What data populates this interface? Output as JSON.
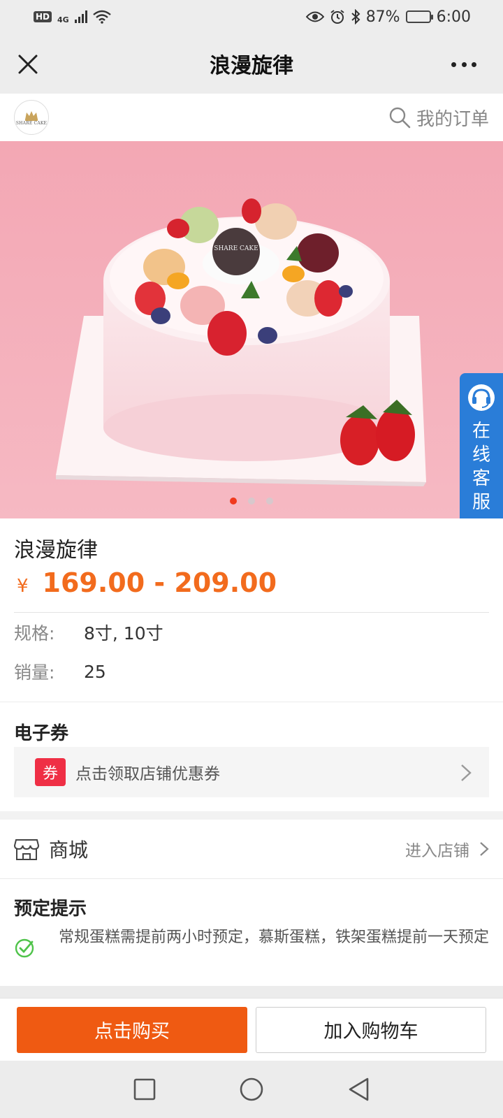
{
  "status_bar": {
    "hd": "HD",
    "network": "4G",
    "battery_percent": "87%",
    "battery_level": 0.87,
    "time": "6:00"
  },
  "header": {
    "title": "浪漫旋律"
  },
  "shop": {
    "logo_text": "SHARE CAKE",
    "orders_label": "我的订单"
  },
  "banner": {
    "image_count": 3,
    "active_index": 0,
    "topper_text": "SHARE CAKE"
  },
  "service": {
    "label": "在线客服"
  },
  "product": {
    "name": "浪漫旋律",
    "currency": "¥",
    "price_range": "169.00 - 209.00",
    "spec_label": "规格:",
    "spec_value": "8寸, 10寸",
    "sales_label": "销量:",
    "sales_value": "25"
  },
  "coupon": {
    "section_title": "电子券",
    "tag": "券",
    "text": "点击领取店铺优惠券"
  },
  "mall": {
    "label": "商城",
    "enter_label": "进入店铺"
  },
  "tips": {
    "title": "预定提示",
    "text": "常规蛋糕需提前两小时预定，慕斯蛋糕，铁架蛋糕提前一天预定"
  },
  "actions": {
    "buy_label": "点击购买",
    "cart_label": "加入购物车"
  },
  "colors": {
    "accent": "#f26b1d",
    "buy_button": "#ef5a12",
    "service_blue": "#2a7dd8",
    "coupon_red": "#ef2f45",
    "check_green": "#4fc34a"
  }
}
